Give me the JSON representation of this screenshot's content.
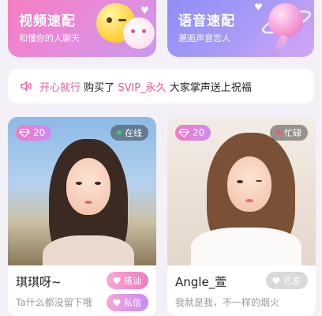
{
  "banners": {
    "video": {
      "title": "视频速配",
      "subtitle": "和懂你的人聊天"
    },
    "voice": {
      "title": "语音速配",
      "subtitle": "邂逅声音恋人"
    }
  },
  "notice": {
    "icon": "speaker-icon",
    "user": "开心就行",
    "action": "购买了",
    "product": "SVIP_永久",
    "message": "大家掌声送上祝福"
  },
  "cards": [
    {
      "diamonds": "20",
      "status": "在线",
      "status_color": "#37c96b",
      "name": "琪琪呀~",
      "bio": "Ta什么都没留下哦",
      "action_primary": "搭讪",
      "action_secondary": "私信"
    },
    {
      "diamonds": "20",
      "status": "忙碌",
      "status_color": "#f05a6a",
      "name": "Angle_萱",
      "bio": "我就是我，不一样的烟火",
      "action_primary": "已发"
    }
  ],
  "colors": {
    "accent_pink": "#f0559a",
    "online": "#37c96b",
    "busy": "#f05a6a"
  }
}
